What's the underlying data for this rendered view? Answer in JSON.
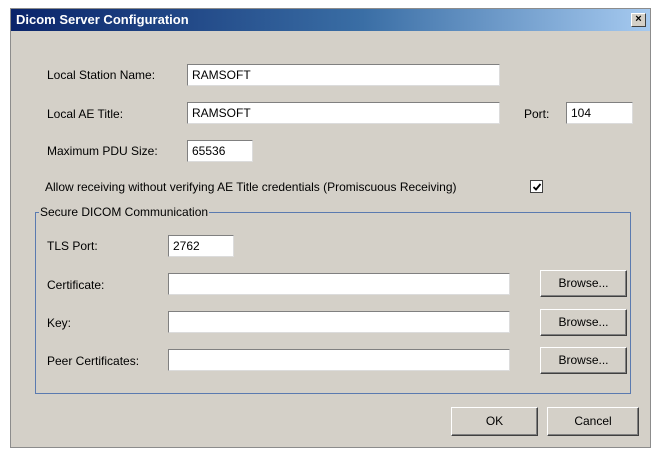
{
  "window": {
    "title": "Dicom Server Configuration",
    "close_symbol": "×"
  },
  "local_station": {
    "label": "Local Station Name:",
    "value": "RAMSOFT"
  },
  "local_ae": {
    "label": "Local AE Title:",
    "value": "RAMSOFT"
  },
  "port": {
    "label": "Port:",
    "value": "104"
  },
  "pdu": {
    "label": "Maximum PDU Size:",
    "value": "65536"
  },
  "promiscuous": {
    "label": "Allow receiving without verifying AE Title credentials (Promiscuous Receiving)",
    "checked": true
  },
  "secure": {
    "legend": "Secure DICOM Communication",
    "tls_port_label": "TLS Port:",
    "tls_port_value": "2762",
    "certificate_label": "Certificate:",
    "certificate_value": "",
    "key_label": "Key:",
    "key_value": "",
    "peer_label": "Peer Certificates:",
    "peer_value": "",
    "browse_label": "Browse..."
  },
  "buttons": {
    "ok": "OK",
    "cancel": "Cancel"
  },
  "icons": {
    "close": "close-icon",
    "check": "checkmark-icon"
  }
}
